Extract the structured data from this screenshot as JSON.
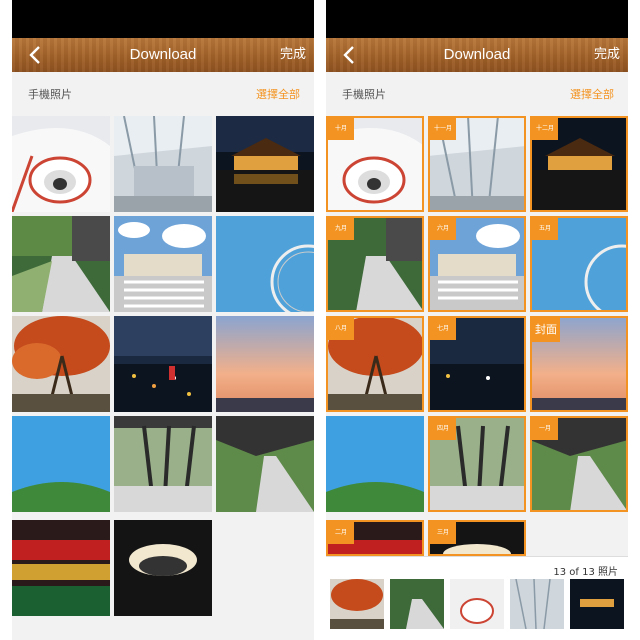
{
  "colors": {
    "accent": "#f39422",
    "header_wood": "#a8672c"
  },
  "left": {
    "header": {
      "back_icon": "chevron-left-icon",
      "title": "Download",
      "done_label": "完成"
    },
    "subbar": {
      "label": "手機照片",
      "select_all": "選擇全部"
    }
  },
  "right": {
    "header": {
      "back_icon": "chevron-left-icon",
      "title": "Download",
      "done_label": "完成"
    },
    "subbar": {
      "label": "手機照片",
      "select_all": "選擇全部"
    },
    "badges": [
      "十月",
      "十一月",
      "十二月",
      "九月",
      "六月",
      "五月",
      "八月",
      "七月",
      "封面",
      "四月",
      "一月",
      "二月",
      "三月"
    ],
    "count": "13 of 13 照片"
  },
  "photos": [
    "spiral staircase",
    "glass atrium",
    "temple night reflection",
    "tree-lined walkway",
    "station plaza",
    "ferris wheel",
    "red maple tree",
    "city night view",
    "sunset sea",
    "green hill",
    "tree trunks hall",
    "canopy walkway",
    "night market",
    "round skylight stairs"
  ]
}
